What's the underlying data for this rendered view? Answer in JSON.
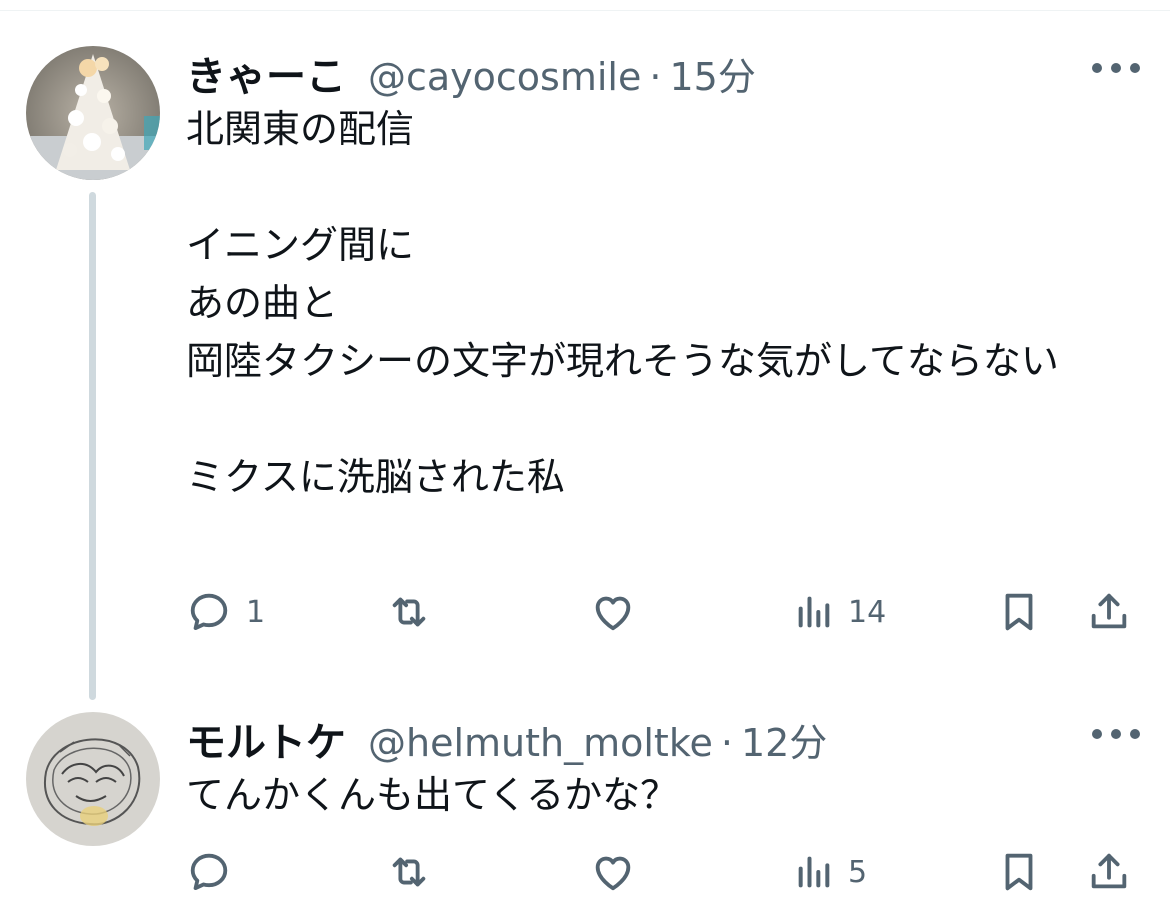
{
  "tweets": [
    {
      "display_name": "きゃーこ",
      "handle": "@cayocosmile",
      "separator": "·",
      "time": "15分",
      "text": "北関東の配信\n\nイニング間に\nあの曲と\n岡陸タクシーの文字が現れそうな気がしてならない\n\nミクスに洗脳された私",
      "replies": "1",
      "retweets": "",
      "likes": "",
      "views": "14",
      "avatar_icon": "cake-photo-avatar"
    },
    {
      "display_name": "モルトケ",
      "handle": "@helmuth_moltke",
      "separator": "·",
      "time": "12分",
      "text": "てんかくんも出てくるかな？",
      "replies": "",
      "retweets": "",
      "likes": "",
      "views": "5",
      "avatar_icon": "sketch-drawing-avatar"
    }
  ],
  "colors": {
    "text_primary": "#0f1419",
    "text_secondary": "#536471",
    "thread_line": "#cfd9de",
    "divider": "#eff3f4"
  },
  "icons": {
    "reply": "reply-icon",
    "retweet": "retweet-icon",
    "like": "like-icon",
    "views": "views-icon",
    "bookmark": "bookmark-icon",
    "share": "share-icon",
    "more": "more-icon"
  }
}
